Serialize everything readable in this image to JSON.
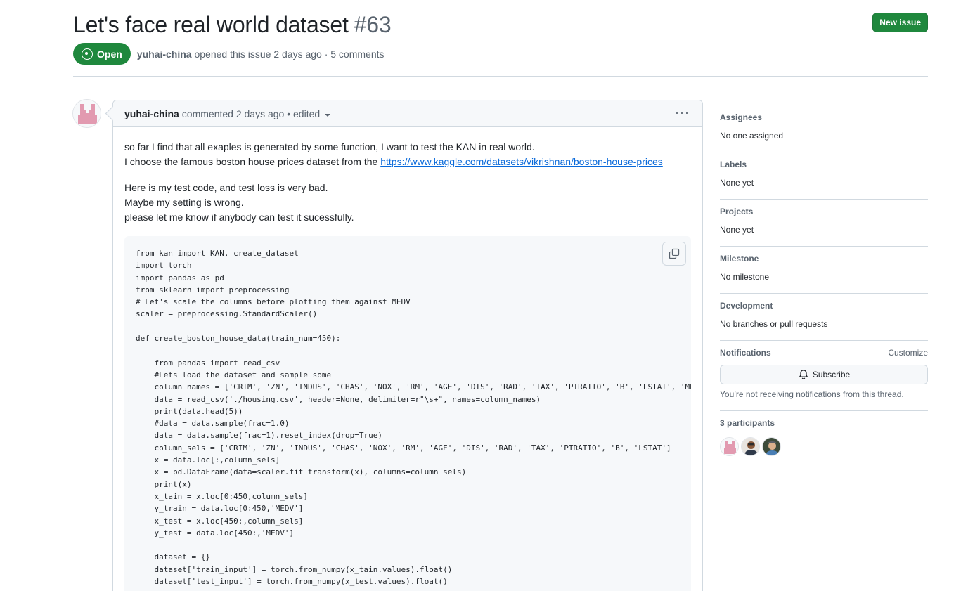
{
  "issue": {
    "title": "Let's face real world dataset",
    "number": "#63",
    "state": "Open",
    "author": "yuhai-china",
    "meta": "opened this issue 2 days ago · 5 comments"
  },
  "toolbar": {
    "new_issue_label": "New issue"
  },
  "comment": {
    "author": "yuhai-china",
    "meta": "commented 2 days ago • edited",
    "paragraph1_line1": "so far I find that all exaples is generated by some function, I want to test the KAN in real world.",
    "paragraph1_line2_prefix": "I choose the famous boston house prices dataset from the ",
    "link": "https://www.kaggle.com/datasets/vikrishnan/boston-house-prices",
    "paragraph2_line1": "Here is my test code, and test loss is very bad.",
    "paragraph2_line2": "Maybe my setting is wrong.",
    "paragraph2_line3": "please let me know if anybody can test it sucessfully.",
    "code": "from kan import KAN, create_dataset\nimport torch\nimport pandas as pd\nfrom sklearn import preprocessing\n# Let's scale the columns before plotting them against MEDV\nscaler = preprocessing.StandardScaler()\n\ndef create_boston_house_data(train_num=450):\n\n    from pandas import read_csv\n    #Lets load the dataset and sample some\n    column_names = ['CRIM', 'ZN', 'INDUS', 'CHAS', 'NOX', 'RM', 'AGE', 'DIS', 'RAD', 'TAX', 'PTRATIO', 'B', 'LSTAT', 'MEDV']\n    data = read_csv('./housing.csv', header=None, delimiter=r\"\\s+\", names=column_names)\n    print(data.head(5))\n    #data = data.sample(frac=1.0)\n    data = data.sample(frac=1).reset_index(drop=True)\n    column_sels = ['CRIM', 'ZN', 'INDUS', 'CHAS', 'NOX', 'RM', 'AGE', 'DIS', 'RAD', 'TAX', 'PTRATIO', 'B', 'LSTAT']\n    x = data.loc[:,column_sels]\n    x = pd.DataFrame(data=scaler.fit_transform(x), columns=column_sels)\n    print(x)\n    x_tain = x.loc[0:450,column_sels]\n    y_train = data.loc[0:450,'MEDV']\n    x_test = x.loc[450:,column_sels]\n    y_test = data.loc[450:,'MEDV']\n\n    dataset = {}\n    dataset['train_input'] = torch.from_numpy(x_tain.values).float()\n    dataset['test_input'] = torch.from_numpy(x_test.values).float()"
  },
  "sidebar": {
    "assignees": {
      "title": "Assignees",
      "value": "No one assigned"
    },
    "labels": {
      "title": "Labels",
      "value": "None yet"
    },
    "projects": {
      "title": "Projects",
      "value": "None yet"
    },
    "milestone": {
      "title": "Milestone",
      "value": "No milestone"
    },
    "development": {
      "title": "Development",
      "value": "No branches or pull requests"
    },
    "notifications": {
      "title": "Notifications",
      "customize": "Customize",
      "subscribe": "Subscribe",
      "note": "You’re not receiving notifications from this thread."
    },
    "participants": {
      "title": "3 participants"
    }
  },
  "colors": {
    "open_green": "#1f883d",
    "link_blue": "#0969da",
    "muted": "#59636e",
    "border": "#d1d9e0"
  }
}
